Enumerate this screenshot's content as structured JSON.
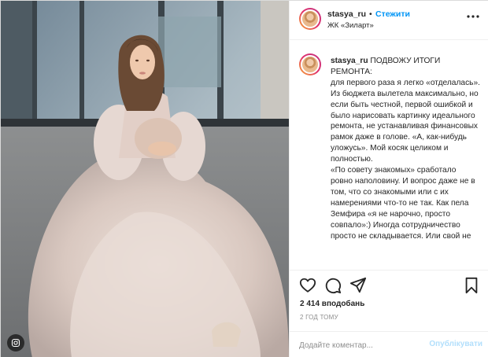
{
  "post": {
    "username": "stasya_ru",
    "separator": "•",
    "follow_label": "Стежити",
    "location": "ЖК «Зиларт»",
    "caption_username": "stasya_ru",
    "caption_text": " ПОДВОЖУ ИТОГИ РЕМОНТА:\nдля первого раза я легко «отделалась».\nИз бюджета вылетела максимально, но если быть честной, первой ошибкой и было нарисовать картинку идеального ремонта, не устанавливая финансовых рамок даже в голове. «А, как-нибудь уложусь». Мой косяк целиком и полностью.\n«По совету знакомых» сработало ровно наполовину. И вопрос даже не в том, что со знакомыми или с их намерениями что-то не так. Как пела Земфира «я не нарочно, просто совпало»:) Иногда сотрудничество просто не складывается. Или свой не",
    "likes": "2 414 вподобань",
    "time_ago": "2 ГОД ТОМУ",
    "comment_placeholder": "Додайте коментар...",
    "publish_label": "Опублікувати"
  },
  "icons": {
    "more": "more-horizontal-icon",
    "like": "heart-icon",
    "comment": "comment-icon",
    "share": "paper-plane-icon",
    "save": "bookmark-icon",
    "instagram": "instagram-icon"
  },
  "colors": {
    "link_blue": "#0095f6",
    "publish_disabled": "#b2dffc",
    "muted": "#8e8e8e",
    "text": "#262626",
    "border": "#efefef"
  }
}
